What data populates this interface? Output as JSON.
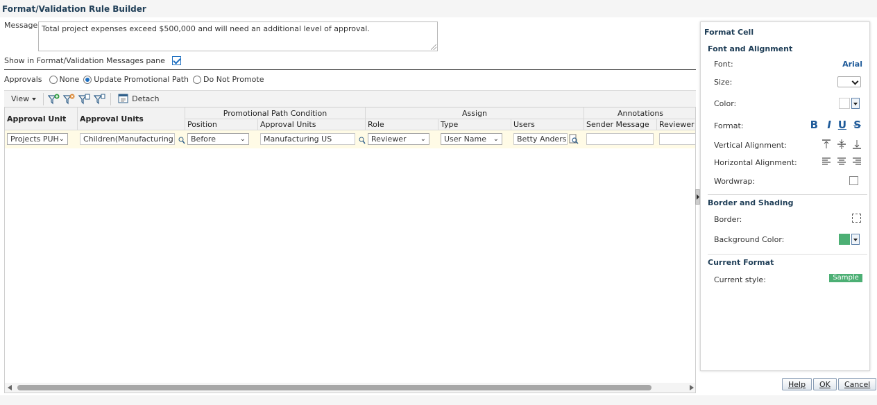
{
  "dialog": {
    "title": "Format/Validation Rule Builder"
  },
  "message": {
    "label": "Message",
    "value": "Total project expenses exceed $500,000 and will need an additional level of approval."
  },
  "show_in_pane": {
    "label": "Show in Format/Validation Messages pane",
    "checked": true
  },
  "approvals": {
    "label": "Approvals",
    "options": [
      "None",
      "Update Promotional Path",
      "Do Not Promote"
    ],
    "selected": "Update Promotional Path"
  },
  "toolbar": {
    "view_label": "View",
    "detach_label": "Detach"
  },
  "grid": {
    "group_headers": {
      "promo_path": "Promotional Path Condition",
      "assign": "Assign",
      "annotations": "Annotations"
    },
    "columns": {
      "approval_unit": "Approval Unit",
      "approval_units": "Approval Units",
      "position": "Position",
      "promo_approval_units": "Approval Units",
      "role": "Role",
      "type": "Type",
      "users": "Users",
      "sender_message": "Sender Message",
      "reviewer_message": "Reviewer M"
    },
    "row": {
      "approval_unit": "Projects PUH",
      "approval_units": "Children(Manufacturing US",
      "position": "Before",
      "promo_approval_units": "Manufacturing US",
      "role": "Reviewer",
      "type": "User Name",
      "users": "Betty Anderson",
      "sender_message": "",
      "reviewer_message": ""
    }
  },
  "format_panel": {
    "title": "Format Cell",
    "font_section": "Font and Alignment",
    "font_label": "Font:",
    "font_value": "Arial",
    "size_label": "Size:",
    "color_label": "Color:",
    "format_label": "Format:",
    "format_buttons": [
      "B",
      "I",
      "U",
      "S"
    ],
    "valign_label": "Vertical Alignment:",
    "halign_label": "Horizontal Alignment:",
    "wordwrap_label": "Wordwrap:",
    "border_section": "Border and Shading",
    "border_label": "Border:",
    "bg_label": "Background Color:",
    "bg_color": "#4caf74",
    "current_section": "Current Format",
    "current_label": "Current style:",
    "sample_text": "Sample"
  },
  "footer": {
    "help": "Help",
    "ok": "OK",
    "cancel": "Cancel"
  }
}
